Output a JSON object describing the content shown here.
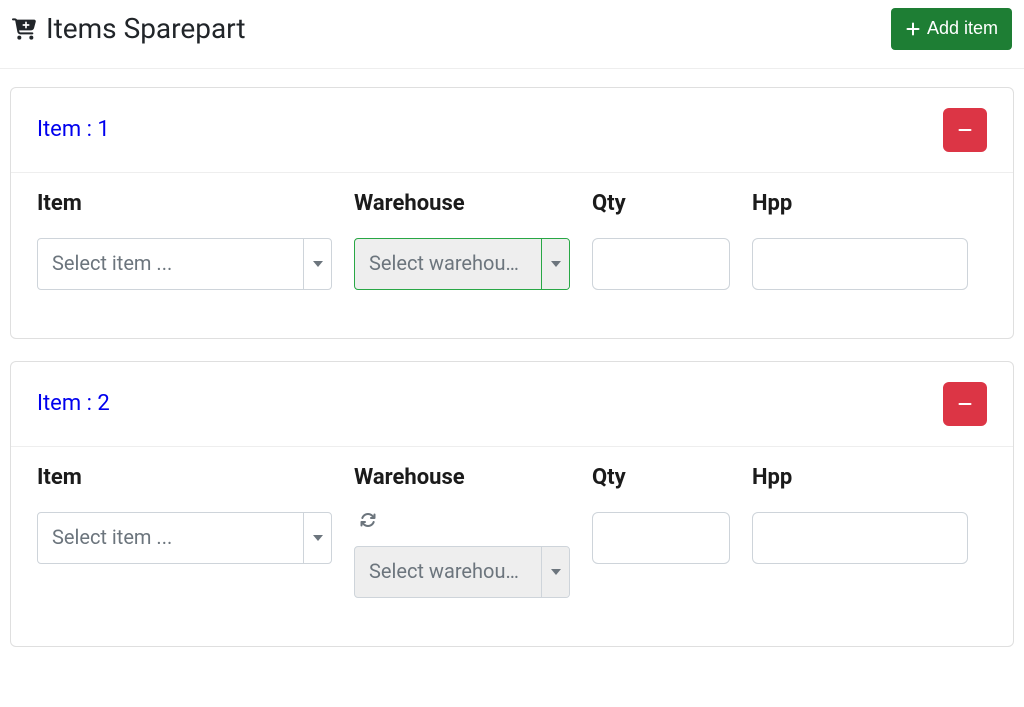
{
  "header": {
    "title": "Items Sparepart",
    "add_item_label": "Add item"
  },
  "labels": {
    "item": "Item",
    "warehouse": "Warehouse",
    "qty": "Qty",
    "hpp": "Hpp"
  },
  "placeholders": {
    "item_select": "Select item ...",
    "warehouse_select": "Select warehou…"
  },
  "items": [
    {
      "index_label": "Item : 1",
      "item_value": "",
      "warehouse_value": "",
      "warehouse_loading": false,
      "warehouse_focused": true,
      "qty": "",
      "hpp": ""
    },
    {
      "index_label": "Item : 2",
      "item_value": "",
      "warehouse_value": "",
      "warehouse_loading": true,
      "warehouse_focused": false,
      "qty": "",
      "hpp": ""
    }
  ]
}
